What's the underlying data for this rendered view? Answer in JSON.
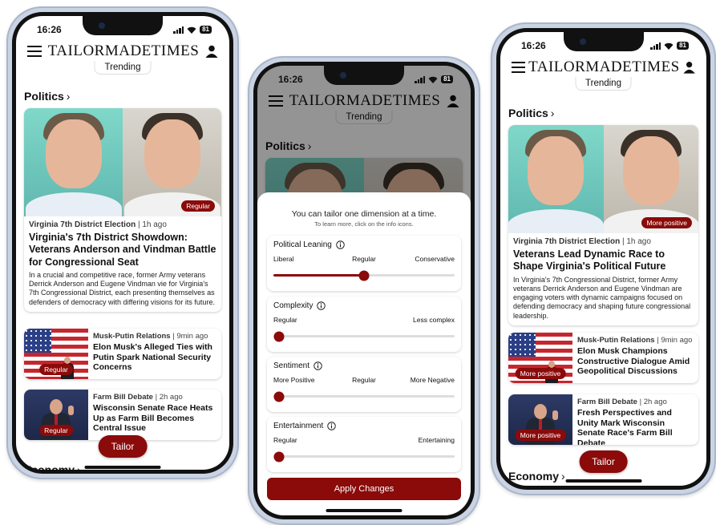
{
  "status": {
    "time": "16:26",
    "battery": "81"
  },
  "brand": "TAILORMADETIMES",
  "trending_label": "Trending",
  "section": {
    "politics": "Politics",
    "economy": "Economy",
    "chevron": "›"
  },
  "tailor_label": "Tailor",
  "colors": {
    "accent": "#8b0a0a",
    "card_shadow": "rgba(0,0,0,0.2)"
  },
  "left_phone": {
    "hero": {
      "category": "Virginia 7th District Election",
      "time": " | 1h ago",
      "badge": "Regular",
      "headline": "Virginia's 7th District Showdown: Veterans Anderson and Vindman Battle for Congressional Seat",
      "summary": "In a crucial and competitive race, former Army veterans Derrick Anderson and Eugene Vindman vie for Virginia's 7th Congressional District, each presenting themselves as defenders of democracy with differing visions for its future."
    },
    "cards": [
      {
        "category": "Musk-Putin Relations",
        "time": " | 9min ago",
        "badge": "Regular",
        "headline": "Elon Musk's Alleged Ties with Putin Spark National Security Concerns"
      },
      {
        "category": "Farm Bill Debate",
        "time": " | 2h ago",
        "badge": "Regular",
        "headline": "Wisconsin Senate Race Heats Up as Farm Bill Becomes Central Issue"
      }
    ]
  },
  "middle_phone": {
    "sheet_title": "You can tailor one dimension at a time.",
    "sheet_subtitle": "To learn more, click on the info icons.",
    "dimensions": [
      {
        "title": "Political Leaning",
        "labels": [
          "Liberal",
          "Regular",
          "Conservative"
        ],
        "value": 0.5
      },
      {
        "title": "Complexity",
        "labels": [
          "Regular",
          "Less complex"
        ],
        "value": 0.0
      },
      {
        "title": "Sentiment",
        "labels": [
          "More Positive",
          "Regular",
          "More Negative"
        ],
        "value": 0.0
      },
      {
        "title": "Entertainment",
        "labels": [
          "Regular",
          "Entertaining"
        ],
        "value": 0.0
      }
    ],
    "apply_label": "Apply Changes"
  },
  "right_phone": {
    "hero": {
      "category": "Virginia 7th District Election",
      "time": " | 1h ago",
      "badge": "More positive",
      "headline": "Veterans Lead Dynamic Race to Shape Virginia's Political Future",
      "summary": "In Virginia's 7th Congressional District, former Army veterans Derrick Anderson and Eugene Vindman are engaging voters with dynamic campaigns focused on defending democracy and shaping future congressional leadership."
    },
    "cards": [
      {
        "category": "Musk-Putin Relations",
        "time": " | 9min ago",
        "badge": "More positive",
        "headline": "Elon Musk Champions Constructive Dialogue Amid Geopolitical Discussions"
      },
      {
        "category": "Farm Bill Debate",
        "time": " | 2h ago",
        "badge": "More positive",
        "headline": "Fresh Perspectives and Unity Mark Wisconsin Senate Race's Farm Bill Debate"
      }
    ]
  }
}
